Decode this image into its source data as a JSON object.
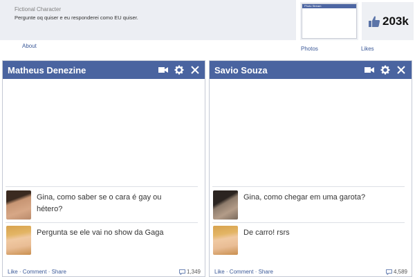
{
  "page": {
    "category": "Fictional Character",
    "about_text": "Pergunte oq quiser e eu responderei como EU quiser.",
    "about_link": "About",
    "photos_header": "Photo Stream",
    "photos_link": "Photos",
    "likes_count": "203k",
    "likes_link": "Likes"
  },
  "chats": [
    {
      "title": "Matheus Denezine",
      "messages": [
        {
          "text": "Gina, como saber se o cara é gay ou hétero?"
        },
        {
          "text": "Pergunta se ele vai no show da Gaga"
        }
      ],
      "footer": {
        "like": "Like",
        "comment": "Comment",
        "share": "Share",
        "sep": " · ",
        "count": "1,349"
      }
    },
    {
      "title": "Savio Souza",
      "messages": [
        {
          "text": "Gina, como chegar em uma garota?"
        },
        {
          "text": "De carro! rsrs"
        }
      ],
      "footer": {
        "like": "Like",
        "comment": "Comment",
        "share": "Share",
        "sep": " · ",
        "count": "4,589"
      }
    }
  ],
  "colors": {
    "header_blue": "#4a64a0",
    "link_blue": "#3b5998"
  },
  "icons": [
    "video-icon",
    "gear-icon",
    "close-icon",
    "thumbs-up-icon",
    "comment-icon"
  ]
}
